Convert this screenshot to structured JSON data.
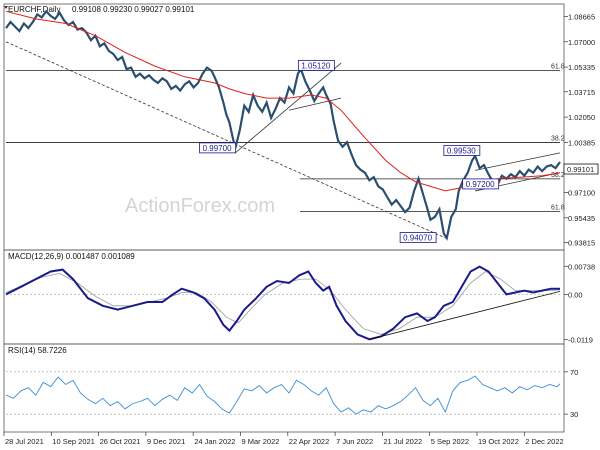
{
  "header": {
    "symbol": "EURCHF,Daily",
    "ohlc": "0.99108 0.99230 0.99027 0.99101"
  },
  "watermark": "ActionForex.com",
  "chart_data": [
    {
      "type": "line",
      "panel": "price",
      "title": "EURCHF,Daily 0.99108 0.99230 0.99027 0.99101",
      "x_tick_labels": [
        "28 Jul 2021",
        "10 Sep 2021",
        "26 Oct 2021",
        "9 Dec 2021",
        "24 Jan 2022",
        "9 Mar 2022",
        "22 Apr 2022",
        "7 Jun 2022",
        "21 Jul 2022",
        "5 Sep 2022",
        "19 Oct 2022",
        "2 Dec 2022"
      ],
      "y_tick_labels": [
        "1.08665",
        "1.07000",
        "1.05335",
        "1.03715",
        "1.02050",
        "1.00385",
        "0.98785",
        "0.97100",
        "0.95435",
        "0.93815"
      ],
      "ylim": [
        0.9345,
        1.0935
      ],
      "current_price_label": "0.99101",
      "moving_average_color": "#e02020",
      "price_color": "#2b4f6e",
      "price_path": [
        [
          0,
          1.079
        ],
        [
          3,
          1.083
        ],
        [
          6,
          1.08
        ],
        [
          9,
          1.077
        ],
        [
          12,
          1.082
        ],
        [
          15,
          1.079
        ],
        [
          18,
          1.083
        ],
        [
          21,
          1.088
        ],
        [
          24,
          1.086
        ],
        [
          27,
          1.09
        ],
        [
          30,
          1.087
        ],
        [
          33,
          1.085
        ],
        [
          36,
          1.089
        ],
        [
          39,
          1.084
        ],
        [
          42,
          1.081
        ],
        [
          45,
          1.083
        ],
        [
          48,
          1.078
        ],
        [
          51,
          1.079
        ],
        [
          54,
          1.076
        ],
        [
          57,
          1.071
        ],
        [
          60,
          1.074
        ],
        [
          63,
          1.067
        ],
        [
          66,
          1.069
        ],
        [
          69,
          1.064
        ],
        [
          72,
          1.062
        ],
        [
          75,
          1.058
        ],
        [
          78,
          1.06
        ],
        [
          81,
          1.052
        ],
        [
          84,
          1.053
        ],
        [
          87,
          1.047
        ],
        [
          90,
          1.049
        ],
        [
          93,
          1.046
        ],
        [
          96,
          1.048
        ],
        [
          99,
          1.045
        ],
        [
          102,
          1.043
        ],
        [
          105,
          1.046
        ],
        [
          108,
          1.044
        ],
        [
          111,
          1.039
        ],
        [
          114,
          1.041
        ],
        [
          117,
          1.038
        ],
        [
          120,
          1.042
        ],
        [
          123,
          1.044
        ],
        [
          126,
          1.04
        ],
        [
          129,
          1.043
        ],
        [
          132,
          1.049
        ],
        [
          135,
          1.053
        ],
        [
          138,
          1.051
        ],
        [
          140,
          1.047
        ],
        [
          143,
          1.04
        ],
        [
          146,
          1.03
        ],
        [
          148,
          1.022
        ],
        [
          150,
          1.017
        ],
        [
          152,
          1.008
        ],
        [
          154,
          1.0
        ],
        [
          157,
          1.012
        ],
        [
          160,
          1.028
        ],
        [
          163,
          1.024
        ],
        [
          166,
          1.035
        ],
        [
          169,
          1.028
        ],
        [
          172,
          1.024
        ],
        [
          175,
          1.03
        ],
        [
          178,
          1.02
        ],
        [
          181,
          1.026
        ],
        [
          184,
          1.033
        ],
        [
          187,
          1.03
        ],
        [
          190,
          1.04
        ],
        [
          193,
          1.036
        ],
        [
          196,
          1.049
        ],
        [
          198,
          1.052
        ],
        [
          201,
          1.044
        ],
        [
          204,
          1.038
        ],
        [
          207,
          1.031
        ],
        [
          210,
          1.036
        ],
        [
          213,
          1.04
        ],
        [
          215,
          1.035
        ],
        [
          218,
          1.029
        ],
        [
          220,
          1.018
        ],
        [
          223,
          1.005
        ],
        [
          226,
          1.001
        ],
        [
          229,
          1.004
        ],
        [
          232,
          0.996
        ],
        [
          235,
          0.989
        ],
        [
          238,
          0.986
        ],
        [
          241,
          0.984
        ],
        [
          244,
          0.979
        ],
        [
          247,
          0.981
        ],
        [
          250,
          0.975
        ],
        [
          253,
          0.973
        ],
        [
          256,
          0.968
        ],
        [
          259,
          0.963
        ],
        [
          262,
          0.966
        ],
        [
          265,
          0.962
        ],
        [
          268,
          0.958
        ],
        [
          271,
          0.961
        ],
        [
          274,
          0.972
        ],
        [
          277,
          0.98
        ],
        [
          280,
          0.97
        ],
        [
          283,
          0.96
        ],
        [
          285,
          0.953
        ],
        [
          288,
          0.955
        ],
        [
          291,
          0.96
        ],
        [
          294,
          0.944
        ],
        [
          296,
          0.941
        ],
        [
          299,
          0.955
        ],
        [
          302,
          0.96
        ],
        [
          304,
          0.972
        ],
        [
          307,
          0.979
        ],
        [
          310,
          0.984
        ],
        [
          313,
          0.992
        ],
        [
          315,
          0.995
        ],
        [
          318,
          0.987
        ],
        [
          321,
          0.989
        ],
        [
          324,
          0.983
        ],
        [
          327,
          0.978
        ],
        [
          330,
          0.976
        ],
        [
          333,
          0.982
        ],
        [
          336,
          0.98
        ],
        [
          339,
          0.983
        ],
        [
          342,
          0.981
        ],
        [
          345,
          0.985
        ],
        [
          348,
          0.982
        ],
        [
          351,
          0.986
        ],
        [
          354,
          0.984
        ],
        [
          357,
          0.988
        ],
        [
          360,
          0.985
        ],
        [
          363,
          0.988
        ],
        [
          366,
          0.989
        ],
        [
          369,
          0.987
        ],
        [
          372,
          0.991
        ]
      ],
      "moving_average_path": [
        [
          0,
          1.09
        ],
        [
          20,
          1.085
        ],
        [
          40,
          1.082
        ],
        [
          60,
          1.074
        ],
        [
          80,
          1.063
        ],
        [
          100,
          1.054
        ],
        [
          120,
          1.047
        ],
        [
          140,
          1.043
        ],
        [
          150,
          1.039
        ],
        [
          160,
          1.036
        ],
        [
          175,
          1.033
        ],
        [
          190,
          1.033
        ],
        [
          205,
          1.035
        ],
        [
          215,
          1.033
        ],
        [
          225,
          1.025
        ],
        [
          240,
          1.008
        ],
        [
          255,
          0.992
        ],
        [
          265,
          0.984
        ],
        [
          275,
          0.978
        ],
        [
          285,
          0.975
        ],
        [
          295,
          0.972
        ],
        [
          305,
          0.974
        ],
        [
          315,
          0.977
        ],
        [
          330,
          0.98
        ],
        [
          345,
          0.981
        ],
        [
          360,
          0.982
        ],
        [
          372,
          0.984
        ]
      ],
      "annotations": {
        "boxed_levels": [
          "1.05120",
          "0.99700",
          "0.99530",
          "0.97200",
          "0.94070"
        ],
        "fib_labels": [
          "61.8",
          "38.2",
          "38.2",
          "61.8"
        ]
      }
    },
    {
      "type": "line",
      "panel": "macd",
      "title": "MACD(12,26,9) 0.001487 0.001089",
      "y_tick_labels": [
        "0.00738",
        "0.00",
        "-0.0119"
      ],
      "ylim": [
        -0.0125,
        0.0085
      ],
      "macd_color": "#1a1a8c",
      "signal_color": "#9a9a9a",
      "macd_path": [
        [
          0,
          0.0
        ],
        [
          10,
          0.002
        ],
        [
          20,
          0.004
        ],
        [
          30,
          0.006
        ],
        [
          38,
          0.0065
        ],
        [
          45,
          0.004
        ],
        [
          55,
          -0.001
        ],
        [
          65,
          -0.003
        ],
        [
          75,
          -0.004
        ],
        [
          85,
          -0.003
        ],
        [
          95,
          -0.002
        ],
        [
          105,
          -0.002
        ],
        [
          112,
          0.0
        ],
        [
          118,
          0.0015
        ],
        [
          126,
          0.0005
        ],
        [
          133,
          -0.001
        ],
        [
          140,
          -0.004
        ],
        [
          146,
          -0.008
        ],
        [
          150,
          -0.0095
        ],
        [
          155,
          -0.007
        ],
        [
          160,
          -0.004
        ],
        [
          168,
          -0.001
        ],
        [
          175,
          0.002
        ],
        [
          182,
          0.0035
        ],
        [
          190,
          0.003
        ],
        [
          197,
          0.005
        ],
        [
          203,
          0.006
        ],
        [
          208,
          0.003
        ],
        [
          213,
          0.001
        ],
        [
          217,
          0.002
        ],
        [
          222,
          -0.003
        ],
        [
          228,
          -0.007
        ],
        [
          236,
          -0.0105
        ],
        [
          244,
          -0.0118
        ],
        [
          252,
          -0.011
        ],
        [
          260,
          -0.009
        ],
        [
          268,
          -0.006
        ],
        [
          276,
          -0.005
        ],
        [
          283,
          -0.007
        ],
        [
          288,
          -0.006
        ],
        [
          294,
          -0.003
        ],
        [
          300,
          -0.002
        ],
        [
          306,
          0.002
        ],
        [
          312,
          0.006
        ],
        [
          318,
          0.0073
        ],
        [
          324,
          0.006
        ],
        [
          330,
          0.003
        ],
        [
          336,
          0.0
        ],
        [
          342,
          0.0005
        ],
        [
          348,
          0.001
        ],
        [
          354,
          0.0005
        ],
        [
          360,
          0.001
        ],
        [
          366,
          0.0015
        ],
        [
          372,
          0.0015
        ]
      ],
      "signal_path": [
        [
          0,
          0.0005
        ],
        [
          12,
          0.0025
        ],
        [
          24,
          0.0045
        ],
        [
          36,
          0.0055
        ],
        [
          48,
          0.003
        ],
        [
          60,
          -0.0005
        ],
        [
          72,
          -0.003
        ],
        [
          84,
          -0.003
        ],
        [
          96,
          -0.002
        ],
        [
          108,
          -0.001
        ],
        [
          118,
          0.0005
        ],
        [
          128,
          0.0005
        ],
        [
          138,
          -0.002
        ],
        [
          148,
          -0.006
        ],
        [
          156,
          -0.0075
        ],
        [
          164,
          -0.004
        ],
        [
          174,
          0.0
        ],
        [
          186,
          0.003
        ],
        [
          198,
          0.004
        ],
        [
          208,
          0.004
        ],
        [
          218,
          0.001
        ],
        [
          228,
          -0.004
        ],
        [
          240,
          -0.009
        ],
        [
          252,
          -0.0105
        ],
        [
          264,
          -0.009
        ],
        [
          276,
          -0.006
        ],
        [
          288,
          -0.006
        ],
        [
          300,
          -0.003
        ],
        [
          312,
          0.003
        ],
        [
          322,
          0.006
        ],
        [
          332,
          0.004
        ],
        [
          342,
          0.001
        ],
        [
          354,
          0.001
        ],
        [
          366,
          0.001
        ],
        [
          372,
          0.0012
        ]
      ]
    },
    {
      "type": "line",
      "panel": "rsi",
      "title": "RSI(14) 58.7226",
      "y_tick_labels": [
        "70",
        "30"
      ],
      "ylim": [
        15,
        85
      ],
      "rsi_color": "#3a8fd8",
      "levels": [
        30,
        70
      ],
      "rsi_path": [
        [
          0,
          48
        ],
        [
          5,
          45
        ],
        [
          10,
          52
        ],
        [
          15,
          55
        ],
        [
          20,
          48
        ],
        [
          25,
          60
        ],
        [
          30,
          56
        ],
        [
          35,
          65
        ],
        [
          40,
          58
        ],
        [
          45,
          62
        ],
        [
          50,
          50
        ],
        [
          55,
          44
        ],
        [
          60,
          40
        ],
        [
          65,
          45
        ],
        [
          70,
          38
        ],
        [
          75,
          42
        ],
        [
          80,
          35
        ],
        [
          85,
          40
        ],
        [
          90,
          42
        ],
        [
          95,
          45
        ],
        [
          100,
          38
        ],
        [
          105,
          44
        ],
        [
          110,
          48
        ],
        [
          115,
          43
        ],
        [
          120,
          55
        ],
        [
          125,
          50
        ],
        [
          130,
          58
        ],
        [
          135,
          47
        ],
        [
          140,
          42
        ],
        [
          145,
          35
        ],
        [
          150,
          31
        ],
        [
          155,
          42
        ],
        [
          160,
          54
        ],
        [
          165,
          52
        ],
        [
          170,
          57
        ],
        [
          175,
          50
        ],
        [
          180,
          55
        ],
        [
          185,
          58
        ],
        [
          190,
          50
        ],
        [
          195,
          62
        ],
        [
          200,
          58
        ],
        [
          205,
          52
        ],
        [
          210,
          48
        ],
        [
          215,
          55
        ],
        [
          220,
          40
        ],
        [
          225,
          32
        ],
        [
          230,
          36
        ],
        [
          235,
          30
        ],
        [
          240,
          34
        ],
        [
          245,
          32
        ],
        [
          250,
          38
        ],
        [
          255,
          35
        ],
        [
          260,
          38
        ],
        [
          265,
          42
        ],
        [
          270,
          48
        ],
        [
          275,
          55
        ],
        [
          280,
          43
        ],
        [
          285,
          38
        ],
        [
          290,
          45
        ],
        [
          295,
          32
        ],
        [
          300,
          52
        ],
        [
          305,
          60
        ],
        [
          310,
          62
        ],
        [
          315,
          66
        ],
        [
          320,
          58
        ],
        [
          325,
          55
        ],
        [
          330,
          52
        ],
        [
          335,
          55
        ],
        [
          340,
          50
        ],
        [
          345,
          56
        ],
        [
          350,
          53
        ],
        [
          355,
          57
        ],
        [
          360,
          55
        ],
        [
          365,
          58
        ],
        [
          370,
          56
        ],
        [
          372,
          58.7
        ]
      ]
    }
  ]
}
